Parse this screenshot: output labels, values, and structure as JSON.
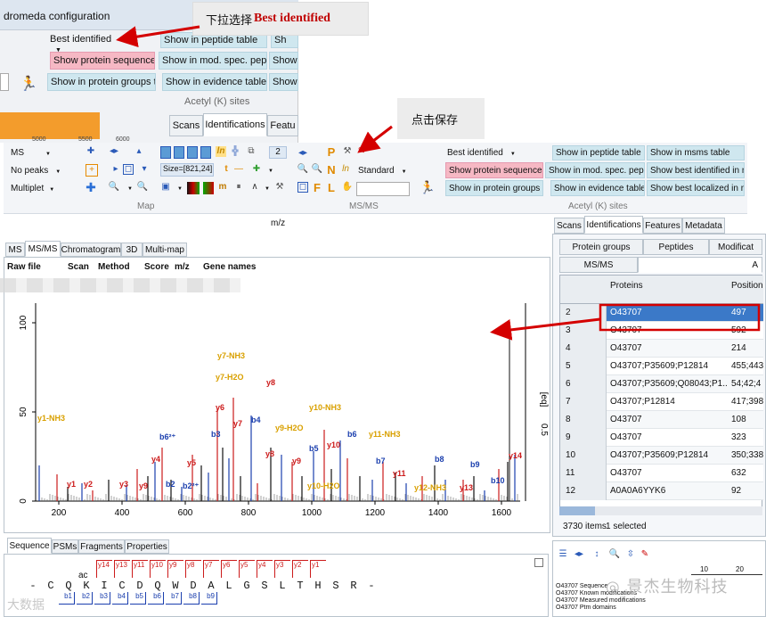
{
  "top_window": {
    "title": "dromeda configuration",
    "dropdown": "Best identified",
    "buttons": [
      "Show in peptide table",
      "Show in mod. spec. pep. ta",
      "Show in evidence table",
      "Show protein sequences",
      "Show in protein groups tab",
      "Sh",
      "Show",
      "Show"
    ],
    "group_label": "Acetyl (K) sites",
    "tabs": [
      "Scans",
      "Identifications",
      "Featu"
    ],
    "axis_ticks": [
      "5000",
      "5500",
      "6000"
    ]
  },
  "callouts": {
    "dropdown_note": "下拉选择",
    "dropdown_note_bold": "Best identified",
    "save_note": "点击保存"
  },
  "toolbar": {
    "left_items": [
      "MS",
      "No peaks",
      "Multiplet"
    ],
    "size_label": "Size=[821,24]",
    "page_num": "2",
    "groups": [
      "Map",
      "MS/MS",
      "Acetyl (K) sites"
    ],
    "standard_label": "Standard",
    "dropdown": "Best identified",
    "buttons": [
      "Show in peptide table",
      "Show in msms table",
      "Show protein sequences",
      "Show in mod. spec. pep. ta",
      "Show best identified in msi",
      "Show in protein groups tab",
      "Show in evidence table",
      "Show best localized in msn"
    ]
  },
  "mz_label": "m/z",
  "left_tabs": [
    "MS",
    "MS/MS",
    "Chromatogram",
    "3D",
    "Multi-map"
  ],
  "table_headers": [
    "Raw file",
    "Scan",
    "Method",
    "Score",
    "m/z",
    "Gene names"
  ],
  "right_tabs": [
    "Scans",
    "Identifications",
    "Features",
    "Metadata"
  ],
  "right_subtabs": [
    "Protein groups",
    "Peptides",
    "Modificat",
    "MS/MS",
    "A"
  ],
  "grid": {
    "columns": [
      "Proteins",
      "Position"
    ],
    "rows": [
      {
        "n": "2",
        "protein": "O43707",
        "pos": "497",
        "selected": true
      },
      {
        "n": "3",
        "protein": "O43707",
        "pos": "592"
      },
      {
        "n": "4",
        "protein": "O43707",
        "pos": "214"
      },
      {
        "n": "5",
        "protein": "O43707;P35609;P12814",
        "pos": "455;443"
      },
      {
        "n": "6",
        "protein": "O43707;P35609;Q08043;P1...",
        "pos": "54;42;4"
      },
      {
        "n": "7",
        "protein": "O43707;P12814",
        "pos": "417;398"
      },
      {
        "n": "8",
        "protein": "O43707",
        "pos": "108"
      },
      {
        "n": "9",
        "protein": "O43707",
        "pos": "323"
      },
      {
        "n": "10",
        "protein": "O43707;P35609;P12814",
        "pos": "350;338"
      },
      {
        "n": "11",
        "protein": "O43707",
        "pos": "632"
      },
      {
        "n": "12",
        "protein": "A0A0A6YYK6",
        "pos": "92"
      }
    ],
    "status_items": "3730 items",
    "status_selected": "1 selected"
  },
  "bottom_tabs": [
    "Sequence",
    "PSMs",
    "Fragments",
    "Properties"
  ],
  "sequence": {
    "letters": [
      "-",
      "C",
      "Q",
      "K",
      "I",
      "C",
      "D",
      "Q",
      "W",
      "D",
      "A",
      "L",
      "G",
      "S",
      "L",
      "T",
      "H",
      "S",
      "R",
      "-"
    ],
    "ac": "ac",
    "y_ions": [
      "y14",
      "y13",
      "y11",
      "y10",
      "y9",
      "y8",
      "y7",
      "y6",
      "y5",
      "y4",
      "y3",
      "y2",
      "y1"
    ],
    "b_ions": [
      "b1",
      "b2",
      "b3",
      "b4",
      "b5",
      "b6",
      "b7",
      "b8",
      "b9"
    ]
  },
  "bottom_right": {
    "lines": [
      "O43707 Sequence",
      "O43707 Known modifications",
      "O43707 Measured modifications",
      "O43707 Ptm domains"
    ],
    "scale": [
      "10",
      "20"
    ]
  },
  "watermarks": [
    "景杰生物科技",
    "大数据"
  ],
  "spectrum": {
    "y_ticks": [
      "0",
      "50",
      "100"
    ],
    "x_ticks": [
      "200",
      "400",
      "600",
      "800",
      "1000",
      "1200",
      "1400",
      "1600"
    ],
    "right_axis": "[eq]",
    "right_ticks": [
      "0.5"
    ],
    "labels": [
      {
        "t": "y1-NH3",
        "c": "gold",
        "x": 38,
        "y": 472
      },
      {
        "t": "y7-NH3",
        "c": "gold",
        "x": 240,
        "y": 402
      },
      {
        "t": "y7-H2O",
        "c": "gold",
        "x": 238,
        "y": 426
      },
      {
        "t": "y8",
        "c": "red",
        "x": 295,
        "y": 432
      },
      {
        "t": "b6²⁺",
        "c": "blue",
        "x": 175,
        "y": 493
      },
      {
        "t": "y6",
        "c": "red",
        "x": 238,
        "y": 460
      },
      {
        "t": "y7",
        "c": "red",
        "x": 258,
        "y": 478
      },
      {
        "t": "b4",
        "c": "blue",
        "x": 278,
        "y": 474
      },
      {
        "t": "b3",
        "c": "blue",
        "x": 233,
        "y": 490
      },
      {
        "t": "y9-H2O",
        "c": "gold",
        "x": 305,
        "y": 483
      },
      {
        "t": "y10-NH3",
        "c": "gold",
        "x": 343,
        "y": 460
      },
      {
        "t": "b6",
        "c": "blue",
        "x": 386,
        "y": 490
      },
      {
        "t": "y11-NH3",
        "c": "gold",
        "x": 410,
        "y": 490
      },
      {
        "t": "b5",
        "c": "blue",
        "x": 343,
        "y": 506
      },
      {
        "t": "y10",
        "c": "red",
        "x": 363,
        "y": 502
      },
      {
        "t": "y4",
        "c": "red",
        "x": 166,
        "y": 518
      },
      {
        "t": "y5",
        "c": "red",
        "x": 206,
        "y": 522
      },
      {
        "t": "y8",
        "c": "red",
        "x": 294,
        "y": 512
      },
      {
        "t": "y9",
        "c": "red",
        "x": 324,
        "y": 520
      },
      {
        "t": "b7",
        "c": "blue",
        "x": 418,
        "y": 520
      },
      {
        "t": "y11",
        "c": "red",
        "x": 437,
        "y": 534
      },
      {
        "t": "b8",
        "c": "blue",
        "x": 484,
        "y": 518
      },
      {
        "t": "b9",
        "c": "blue",
        "x": 524,
        "y": 524
      },
      {
        "t": "y14",
        "c": "red",
        "x": 567,
        "y": 514
      },
      {
        "t": "y10-H2O",
        "c": "gold",
        "x": 341,
        "y": 548
      },
      {
        "t": "y1",
        "c": "red",
        "x": 71,
        "y": 546
      },
      {
        "t": "y2",
        "c": "red",
        "x": 90,
        "y": 546
      },
      {
        "t": "y3",
        "c": "red",
        "x": 130,
        "y": 546
      },
      {
        "t": "y9",
        "c": "red",
        "x": 152,
        "y": 548
      },
      {
        "t": "b2",
        "c": "blue",
        "x": 182,
        "y": 546
      },
      {
        "t": "b2²⁺",
        "c": "blue",
        "x": 201,
        "y": 548
      },
      {
        "t": "y12-NH3",
        "c": "gold",
        "x": 461,
        "y": 550
      },
      {
        "t": "y13",
        "c": "red",
        "x": 512,
        "y": 550
      },
      {
        "t": "b10",
        "c": "blue",
        "x": 547,
        "y": 542
      }
    ],
    "peaks": [
      [
        40,
        20
      ],
      [
        60,
        15
      ],
      [
        72,
        8
      ],
      [
        88,
        10
      ],
      [
        100,
        6
      ],
      [
        118,
        12
      ],
      [
        138,
        9
      ],
      [
        150,
        18
      ],
      [
        162,
        14
      ],
      [
        170,
        22
      ],
      [
        178,
        30
      ],
      [
        188,
        12
      ],
      [
        200,
        8
      ],
      [
        212,
        26
      ],
      [
        222,
        20
      ],
      [
        230,
        16
      ],
      [
        240,
        52
      ],
      [
        246,
        30
      ],
      [
        253,
        24
      ],
      [
        258,
        58
      ],
      [
        266,
        14
      ],
      [
        278,
        48
      ],
      [
        285,
        10
      ],
      [
        300,
        30
      ],
      [
        312,
        26
      ],
      [
        324,
        22
      ],
      [
        335,
        14
      ],
      [
        348,
        28
      ],
      [
        360,
        40
      ],
      [
        368,
        18
      ],
      [
        378,
        34
      ],
      [
        386,
        24
      ],
      [
        400,
        14
      ],
      [
        414,
        12
      ],
      [
        426,
        22
      ],
      [
        440,
        16
      ],
      [
        452,
        10
      ],
      [
        470,
        14
      ],
      [
        484,
        20
      ],
      [
        496,
        12
      ],
      [
        516,
        12
      ],
      [
        528,
        14
      ],
      [
        540,
        6
      ],
      [
        556,
        18
      ],
      [
        566,
        22
      ],
      [
        574,
        26
      ]
    ]
  }
}
